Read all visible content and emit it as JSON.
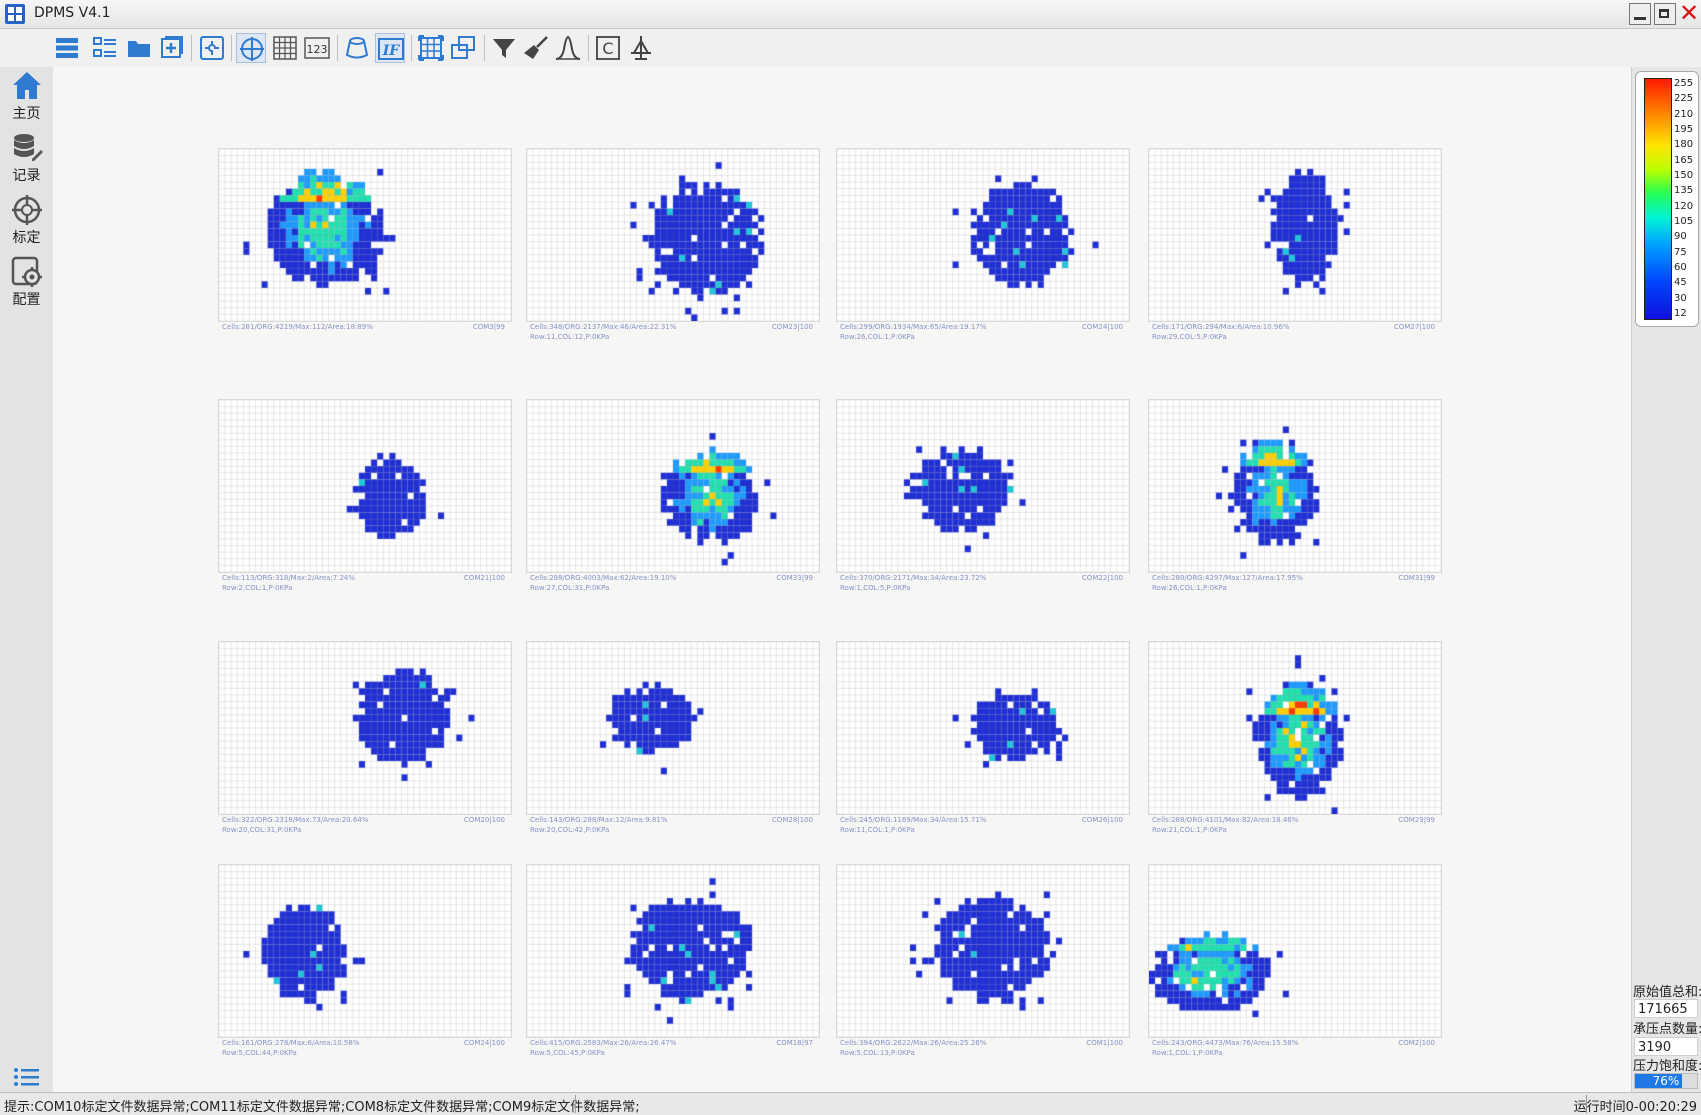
{
  "window": {
    "title": "DPMS V4.1",
    "close_glyph": "✕"
  },
  "toolbar": {
    "buttons": [
      {
        "name": "list-view-icon"
      },
      {
        "name": "detail-view-icon"
      },
      {
        "name": "folder-open-icon"
      },
      {
        "name": "add-icon"
      },
      {
        "name": "puzzle-icon"
      },
      {
        "name": "crosshair-icon"
      },
      {
        "name": "grid-icon"
      },
      {
        "name": "numbers-icon"
      },
      {
        "name": "mold-icon"
      },
      {
        "name": "if-icon"
      },
      {
        "name": "frame-grid-icon"
      },
      {
        "name": "overlap-icon"
      },
      {
        "name": "funnel-icon"
      },
      {
        "name": "sweep-icon"
      },
      {
        "name": "peak-curve-icon"
      },
      {
        "name": "c-icon"
      },
      {
        "name": "balance-icon"
      }
    ],
    "numbers_label": "123",
    "if_label": "IF",
    "c_label": "C"
  },
  "sidebar": {
    "items": [
      {
        "label": "主页",
        "icon": "home-icon"
      },
      {
        "label": "记录",
        "icon": "database-icon"
      },
      {
        "label": "标定",
        "icon": "calibrate-icon"
      },
      {
        "label": "配置",
        "icon": "settings-icon"
      }
    ],
    "bottom_icon": "list-icon"
  },
  "panels": [
    {
      "cap1": "Cells:281/ORG:4219/Max:112/Area:18.89%",
      "cap2": "",
      "com": "COM3|99",
      "heat": true
    },
    {
      "cap1": "Cells:348/ORG:2137/Max:46/Area:22.31%",
      "cap2": "Row:11,COL:12,P:0KPa",
      "com": "COM23|100",
      "heat": false
    },
    {
      "cap1": "Cells:299/ORG:1934/Max:65/Area:19.17%",
      "cap2": "Row:26,COL:1,P:0KPa",
      "com": "COM24|100",
      "heat": false
    },
    {
      "cap1": "Cells:171/ORG:294/Max:6/Area:10.96%",
      "cap2": "Row:29,COL:5,P:0KPa",
      "com": "COM27|100",
      "heat": false
    },
    {
      "cap1": "Cells:113/ORG:318/Max:2/Area:7.24%",
      "cap2": "Row:2,COL:1,P:0KPa",
      "com": "COM21|100",
      "heat": false
    },
    {
      "cap1": "Cells:298/ORG:4003/Max:62/Area:19.10%",
      "cap2": "Row:27,COL:31,P:0KPa",
      "com": "COM33|99",
      "heat": true
    },
    {
      "cap1": "Cells:370/ORG:2171/Max:34/Area:23.72%",
      "cap2": "Row:1,COL:5,P:0KPa",
      "com": "COM22|100",
      "heat": false
    },
    {
      "cap1": "Cells:280/ORG:4297/Max:127/Area:17.95%",
      "cap2": "Row:26,COL:1,P:0KPa",
      "com": "COM31|99",
      "heat": true
    },
    {
      "cap1": "Cells:322/ORG:2318/Max:73/Area:20.64%",
      "cap2": "Row:20,COL:31,P:0KPa",
      "com": "COM20|100",
      "heat": false
    },
    {
      "cap1": "Cells:143/ORG:288/Max:12/Area:9.81%",
      "cap2": "Row:20,COL:42,P:0KPa",
      "com": "COM28|100",
      "heat": false
    },
    {
      "cap1": "Cells:245/ORG:1169/Max:34/Area:15.71%",
      "cap2": "Row:11,COL:1,P:0KPa",
      "com": "COM26|100",
      "heat": false
    },
    {
      "cap1": "Cells:288/ORG:4101/Max:82/Area:18.46%",
      "cap2": "Row:21,COL:1,P:0KPa",
      "com": "COM29|99",
      "heat": true
    },
    {
      "cap1": "Cells:161/ORG:278/Max:6/Area:10.58%",
      "cap2": "Row:5,COL:44,P:0KPa",
      "com": "COM24|100",
      "heat": false
    },
    {
      "cap1": "Cells:415/ORG:2583/Max:26/Area:26.47%",
      "cap2": "Row:5,COL:45,P:0KPa",
      "com": "COM18|97",
      "heat": false
    },
    {
      "cap1": "Cells:394/ORG:2622/Max:26/Area:25.26%",
      "cap2": "Row:5,COL:13,P:0KPa",
      "com": "COM1|100",
      "heat": false
    },
    {
      "cap1": "Cells:243/ORG:4473/Max:76/Area:15.58%",
      "cap2": "Row:1,COL:1,P:0KPa",
      "com": "COM2|100",
      "heat": true
    }
  ],
  "legend": {
    "ticks": [
      "255",
      "225",
      "210",
      "195",
      "180",
      "165",
      "150",
      "135",
      "120",
      "105",
      "90",
      "75",
      "60",
      "45",
      "30",
      "12"
    ]
  },
  "stats": {
    "raw_sum_label": "原始值总和:",
    "raw_sum_value": "171665",
    "points_label": "承压点数量:",
    "points_value": "3190",
    "saturation_label": "压力饱和度:",
    "saturation_value": "76%",
    "saturation_pct": 76
  },
  "status": {
    "message": "提示:COM10标定文件数据异常;COM11标定文件数据异常;COM8标定文件数据异常;COM9标定文件数据异常;",
    "runtime": "运行时间0-00:20:29"
  }
}
